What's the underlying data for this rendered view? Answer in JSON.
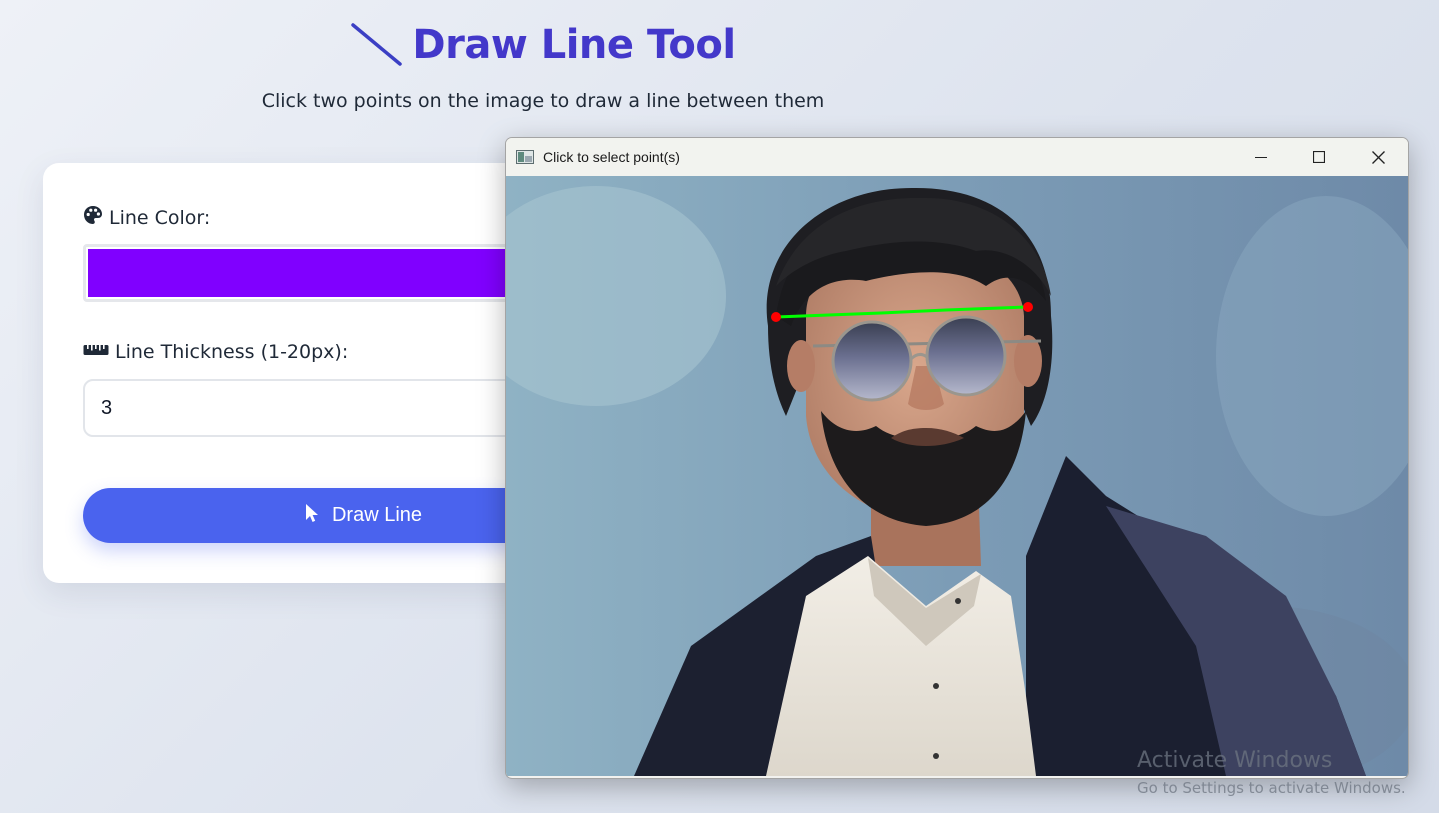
{
  "header": {
    "title": "Draw Line Tool",
    "title_icon": "diagonal-line-icon",
    "subtitle": "Click two points on the image to draw a line between them"
  },
  "form": {
    "color_label": "Line Color:",
    "color_label_icon": "palette-icon",
    "color_value": "#8000ff",
    "thickness_label": "Line Thickness (1-20px):",
    "thickness_label_icon": "ruler-icon",
    "thickness_value": "3",
    "draw_button_label": "Draw Line",
    "draw_button_icon": "cursor-pointer-icon"
  },
  "popup": {
    "window_title": "Click to select point(s)",
    "app_icon": "image-window-icon",
    "minimize_icon": "minimize-icon",
    "maximize_icon": "maximize-icon",
    "close_icon": "close-icon",
    "image_subject": "portrait of a bearded man in sunglasses and dark jacket",
    "line_color": "#00ff00",
    "point_color": "#ff0000"
  },
  "watermark": {
    "title": "Activate Windows",
    "subtitle": "Go to Settings to activate Windows."
  },
  "colors": {
    "accent": "#4338ca",
    "button": "#4a63ee"
  }
}
